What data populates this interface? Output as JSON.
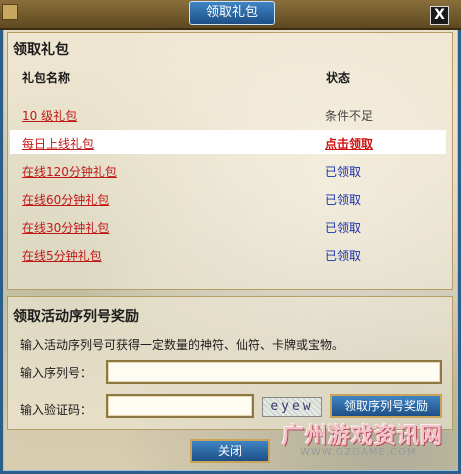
{
  "window": {
    "title": "领取礼包",
    "close_glyph": "X"
  },
  "gift_section": {
    "title": "领取礼包",
    "col_name": "礼包名称",
    "col_status": "状态",
    "rows": [
      {
        "name": "10 级礼包",
        "status": "条件不足"
      },
      {
        "name": "每日上线礼包",
        "status": "点击领取"
      },
      {
        "name": "在线120分钟礼包",
        "status": "已领取"
      },
      {
        "name": "在线60分钟礼包",
        "status": "已领取"
      },
      {
        "name": "在线30分钟礼包",
        "status": "已领取"
      },
      {
        "name": "在线5分钟礼包",
        "status": "已领取"
      }
    ]
  },
  "serial_section": {
    "title": "领取活动序列号奖励",
    "hint": "输入活动序列号可获得一定数量的神符、仙符、卡牌或宝物。",
    "serial_label": "输入序列号：",
    "serial_value": "",
    "captcha_label": "输入验证码：",
    "captcha_value": "",
    "captcha_text": "eyew",
    "claim_button": "领取序列号奖励"
  },
  "close_button": "关闭",
  "watermark": {
    "text": "广州游戏资讯网",
    "url": "WWW.GZGAME.COM"
  },
  "colors": {
    "accent_blue": "#1d4f86",
    "link_red": "#c01818",
    "claimed_blue": "#1a2fa8"
  }
}
